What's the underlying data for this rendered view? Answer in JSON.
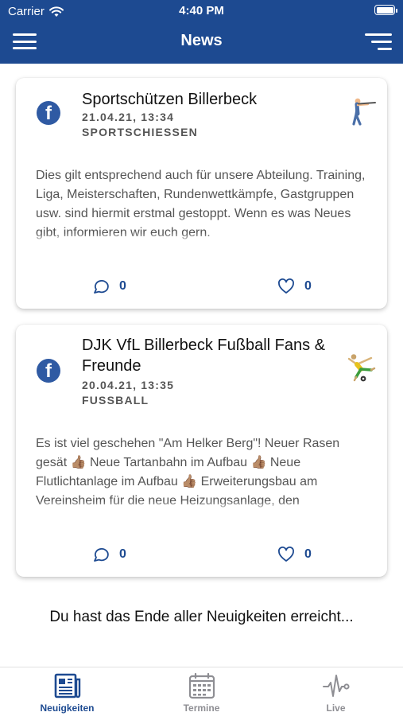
{
  "status_bar": {
    "carrier": "Carrier",
    "time": "4:40 PM"
  },
  "header": {
    "title": "News"
  },
  "posts": [
    {
      "source_icon": "facebook-icon",
      "title": "Sportschützen Billerbeck",
      "date": "21.04.21, 13:34",
      "category": "SPORTSCHIESSEN",
      "sport_icon": "shooting-sport-icon",
      "body": "Dies gilt entsprechend auch für unsere Abteilung. Training, Liga, Meisterschaften, Rundenwettkämpfe, Gastgruppen usw. sind hiermit erstmal gestoppt. Wenn es was Neues gibt, informieren wir euch gern.",
      "comments": "0",
      "likes": "0"
    },
    {
      "source_icon": "facebook-icon",
      "title": "DJK VfL Billerbeck Fußball Fans & Freunde",
      "date": "20.04.21, 13:35",
      "category": "FUSSBALL",
      "sport_icon": "soccer-player-icon",
      "body": "Es ist viel geschehen \"Am Helker Berg\"! Neuer Rasen gesät 👍🏽 Neue Tartanbahn im Aufbau 👍🏽 Neue Flutlichtanlage im Aufbau 👍🏽 Erweiterungsbau am Vereinsheim für die neue Heizungsanlage, den",
      "comments": "0",
      "likes": "0"
    }
  ],
  "end_message": "Du hast das Ende aller Neuigkeiten erreicht...",
  "tabs": [
    {
      "label": "Neuigkeiten",
      "icon": "newspaper-icon",
      "active": true
    },
    {
      "label": "Termine",
      "icon": "calendar-icon",
      "active": false
    },
    {
      "label": "Live",
      "icon": "pulse-icon",
      "active": false
    }
  ],
  "colors": {
    "primary": "#1d4a91",
    "facebook": "#2f5aa3",
    "inactive": "#8e8e93"
  }
}
